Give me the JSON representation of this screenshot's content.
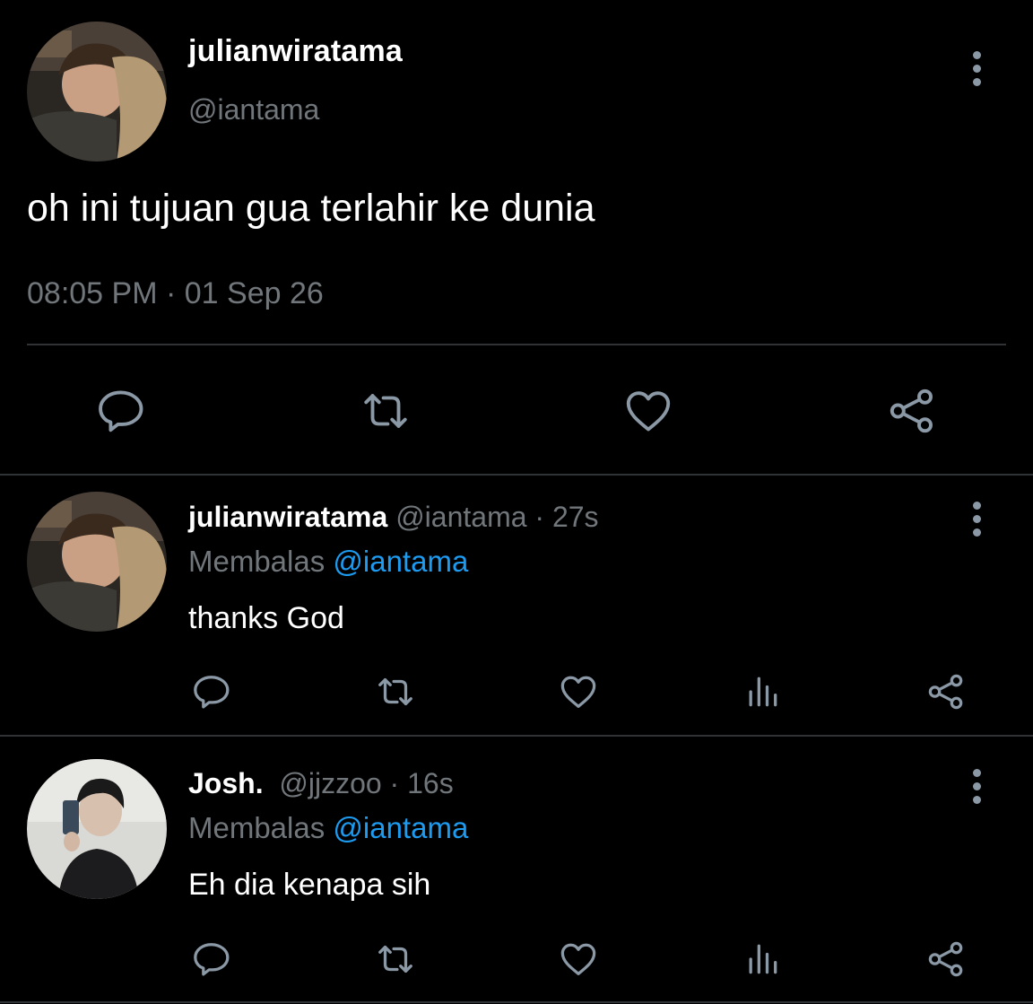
{
  "main_tweet": {
    "display_name": "julianwiratama",
    "handle": "@iantama",
    "text": "oh ini tujuan gua terlahir ke dunia",
    "time": "08:05 PM",
    "separator": " · ",
    "date": "01 Sep 26",
    "actions": [
      "reply-icon",
      "retweet-icon",
      "like-icon",
      "share-icon"
    ]
  },
  "replies": [
    {
      "display_name": "julianwiratama",
      "handle": "@iantama",
      "dot": " · ",
      "time": "27s",
      "replying_label": "Membalas ",
      "replying_to": "@iantama",
      "text": "thanks God",
      "actions": [
        "reply-icon",
        "retweet-icon",
        "like-icon",
        "views-icon",
        "share-icon"
      ]
    },
    {
      "display_name": "Josh.",
      "handle": "@jjzzoo",
      "dot": " · ",
      "time": "16s",
      "replying_label": "Membalas ",
      "replying_to": "@iantama",
      "text": "Eh dia kenapa sih",
      "actions": [
        "reply-icon",
        "retweet-icon",
        "like-icon",
        "views-icon",
        "share-icon"
      ]
    }
  ],
  "colors": {
    "background": "#000000",
    "primary_text": "#ffffff",
    "secondary_text": "#71767b",
    "mention": "#1d9bf0",
    "icon": "#8b98a5",
    "divider": "#2f3336"
  }
}
